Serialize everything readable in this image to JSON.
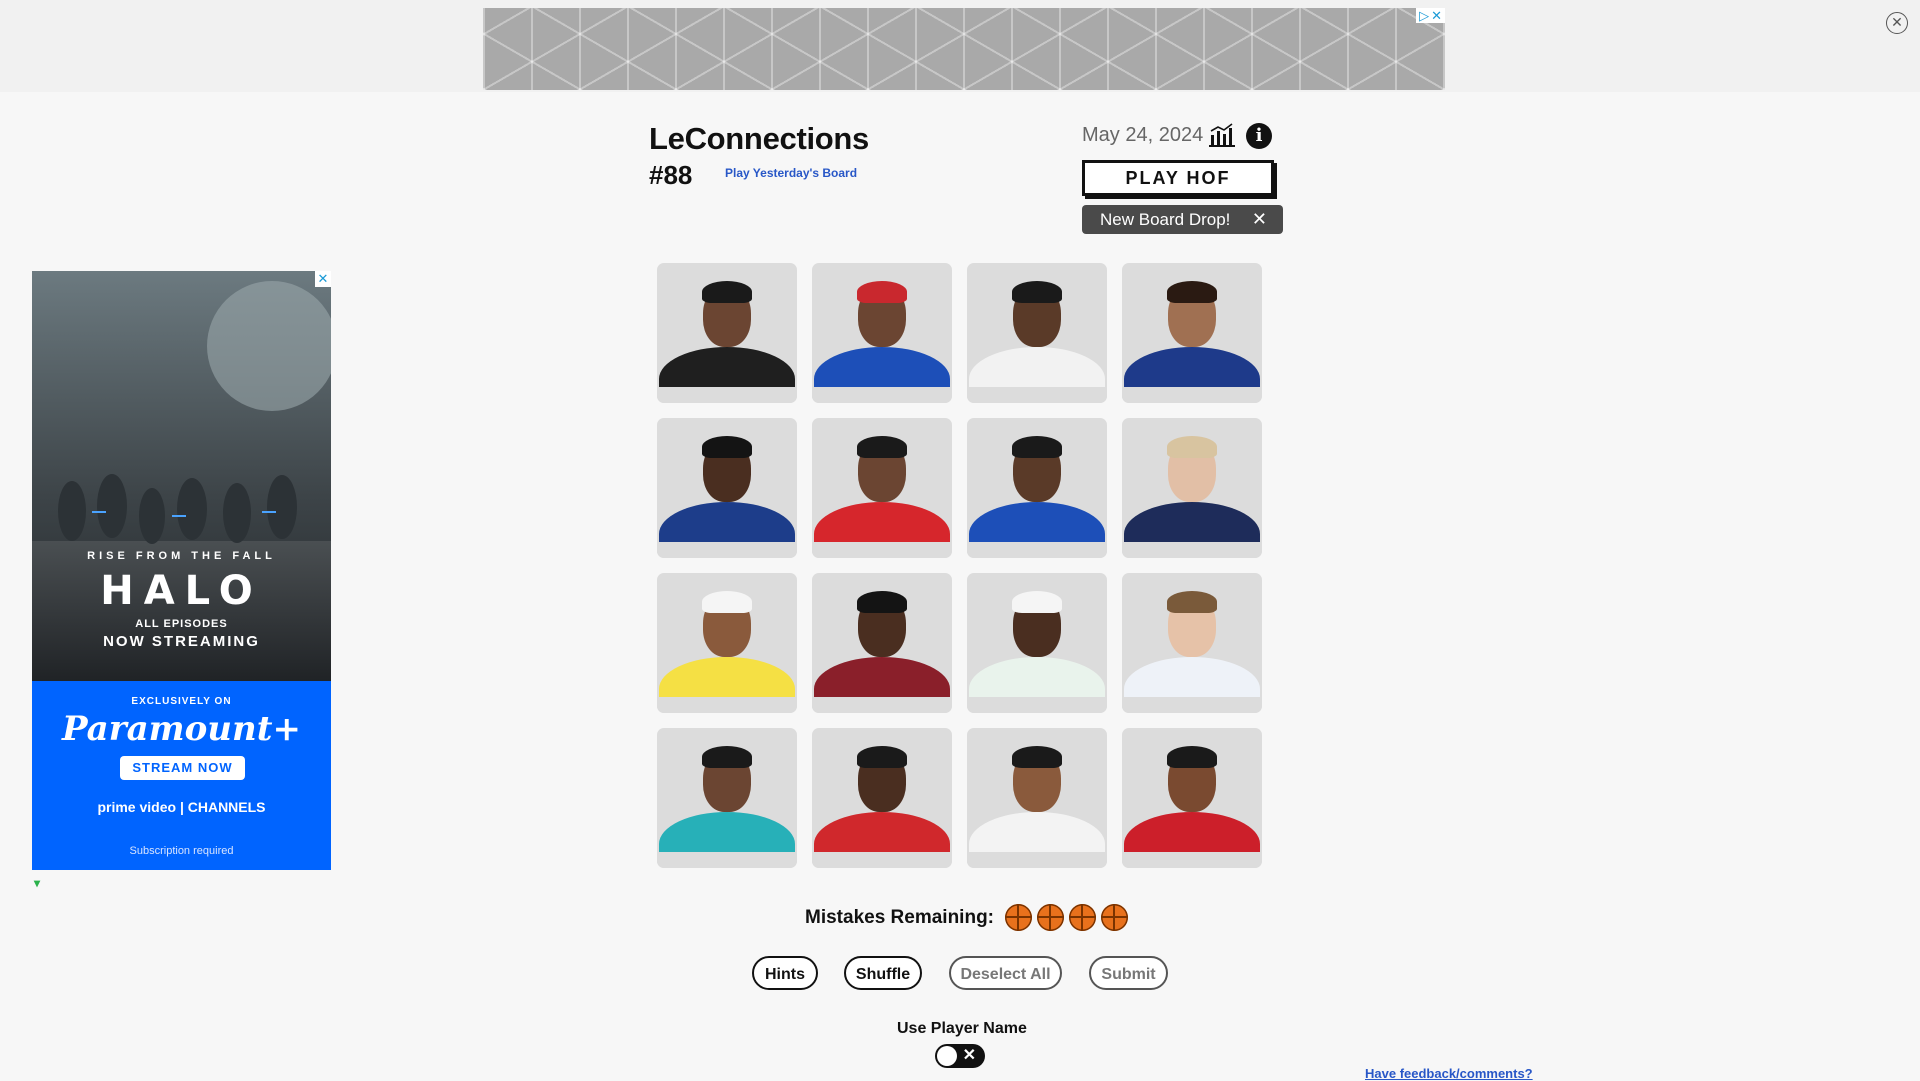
{
  "header": {
    "title": "LeConnections",
    "puzzle_number": "#88",
    "yesterday_link": "Play Yesterday's Board",
    "date": "May 24, 2024",
    "play_hof": "PLAY HOF",
    "toast": "New Board Drop!",
    "toast_close": "✕",
    "info": "i"
  },
  "board": {
    "tiles": [
      {
        "jersey": "#1f1f1f",
        "skin": "#6b4532",
        "hair": "#1a1a1a"
      },
      {
        "jersey": "#1d4fb8",
        "skin": "#6b4532",
        "hair": "#c9282e"
      },
      {
        "jersey": "#f2f2f2",
        "skin": "#5a3a28",
        "hair": "#1a1a1a"
      },
      {
        "jersey": "#1e3a8a",
        "skin": "#a07052",
        "hair": "#2a1a12"
      },
      {
        "jersey": "#1d3d8a",
        "skin": "#4a2e20",
        "hair": "#141414"
      },
      {
        "jersey": "#d6262c",
        "skin": "#6b4532",
        "hair": "#1a1a1a"
      },
      {
        "jersey": "#1d4fb8",
        "skin": "#5a3a28",
        "hair": "#1a1a1a"
      },
      {
        "jersey": "#1e2c5a",
        "skin": "#e2bfa6",
        "hair": "#d8c4a0"
      },
      {
        "jersey": "#f5e044",
        "skin": "#8a5a3c",
        "hair": "#f5f5f5"
      },
      {
        "jersey": "#8a1f2a",
        "skin": "#4a2e20",
        "hair": "#141414"
      },
      {
        "jersey": "#e9f3ec",
        "skin": "#4a2e20",
        "hair": "#f5f5f5"
      },
      {
        "jersey": "#eef2f8",
        "skin": "#e6c2a8",
        "hair": "#7a5a3a"
      },
      {
        "jersey": "#27b0b8",
        "skin": "#6b4532",
        "hair": "#1a1a1a"
      },
      {
        "jersey": "#d0282c",
        "skin": "#4a2e20",
        "hair": "#1a1a1a"
      },
      {
        "jersey": "#f3f3f3",
        "skin": "#8a5a3c",
        "hair": "#1a1a1a"
      },
      {
        "jersey": "#cc1f2a",
        "skin": "#7a4a30",
        "hair": "#1a1a1a"
      }
    ]
  },
  "mistakes": {
    "label": "Mistakes Remaining:",
    "remaining": 4
  },
  "buttons": {
    "hints": "Hints",
    "shuffle": "Shuffle",
    "deselect": "Deselect All",
    "submit": "Submit"
  },
  "toggle": {
    "label": "Use Player Name",
    "state": "off"
  },
  "footer": {
    "feedback": "Have feedback/comments?"
  },
  "side_ad": {
    "line1": "RISE FROM THE FALL",
    "logo": "HALO",
    "line2": "ALL EPISODES",
    "line3": "NOW STREAMING",
    "exclusive": "EXCLUSIVELY ON",
    "brand": "Paramount+",
    "cta": "STREAM NOW",
    "prime": "prime video | CHANNELS",
    "fine_print": "Subscription required"
  }
}
